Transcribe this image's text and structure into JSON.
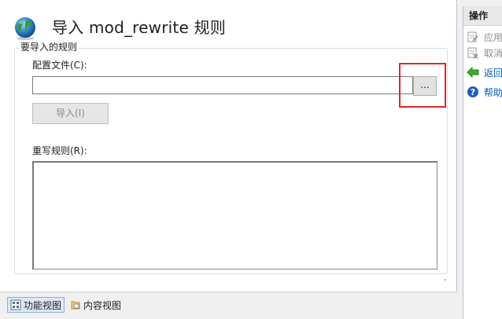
{
  "header": {
    "title": "导入 mod_rewrite 规则",
    "icon": "globe-icon"
  },
  "group": {
    "legend": "要导入的规则"
  },
  "config_file": {
    "label": "配置文件(C):",
    "value": "",
    "browse_label": "..."
  },
  "import_button": {
    "label": "导入(I)"
  },
  "rewrite_rules": {
    "label": "重写规则(R):",
    "value": ""
  },
  "bottom_tabs": [
    {
      "label": "功能视图",
      "icon": "feature-view-icon",
      "active": true
    },
    {
      "label": "内容视图",
      "icon": "content-view-icon",
      "active": false
    }
  ],
  "actions_panel": {
    "title": "操作",
    "items": [
      {
        "label": "应用",
        "icon": "apply-icon",
        "enabled": false
      },
      {
        "label": "取消",
        "icon": "cancel-icon",
        "enabled": false
      },
      {
        "label": "返回",
        "icon": "back-arrow-icon",
        "enabled": true
      },
      {
        "label": "帮助",
        "icon": "help-icon",
        "enabled": true
      }
    ]
  },
  "colors": {
    "highlight": "#e0262a",
    "link": "#0a5cbf",
    "back_arrow": "#3fae2a",
    "help": "#1f5fb8"
  }
}
